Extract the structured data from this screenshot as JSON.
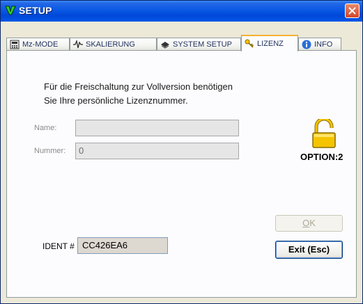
{
  "window": {
    "title": "SETUP"
  },
  "tabs": [
    {
      "label": "Mz-MODE",
      "icon": "calculator-icon"
    },
    {
      "label": "SKALIERUNG",
      "icon": "waveform-icon"
    },
    {
      "label": "SYSTEM SETUP",
      "icon": "chip-icon"
    },
    {
      "label": "LIZENZ",
      "icon": "key-icon",
      "active": true
    },
    {
      "label": "INFO",
      "icon": "info-icon"
    }
  ],
  "license": {
    "instruction_line1": "Für die Freischaltung zur Vollversion benötigen",
    "instruction_line2": "Sie Ihre persönliche Lizenznummer.",
    "name_label": "Name:",
    "name_value": "",
    "number_label": "Nummer:",
    "number_value": "0",
    "option_label": "OPTION:2",
    "lock_icon": "padlock-open-icon"
  },
  "buttons": {
    "ok_label": "OK",
    "ok_mnemonic": "O",
    "ok_rest": "K",
    "exit_label": "Exit (Esc)"
  },
  "ident": {
    "label": "IDENT #",
    "value": "CC426EA6"
  },
  "colors": {
    "title_bar": "#0054e3",
    "close": "#d2452a",
    "active_tab_accent": "#f5b134",
    "lock_gold": "#f5c400"
  }
}
